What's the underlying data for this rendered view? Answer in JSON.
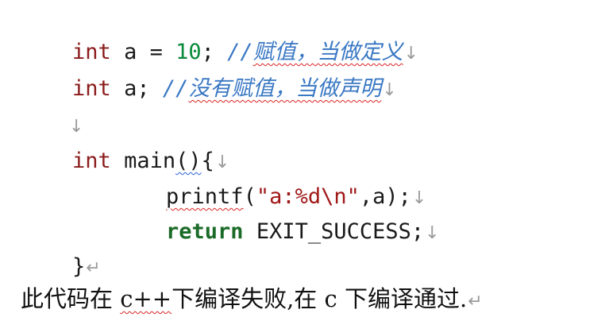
{
  "code": {
    "line1": {
      "type": "int",
      "decl": " a = ",
      "value": "10",
      "semi": "; ",
      "comment_prefix": "//",
      "comment_text": "赋值，当做定义",
      "mark": "↓"
    },
    "line2": {
      "type": "int",
      "decl": " a; ",
      "comment_prefix": "//",
      "comment_text": "没有赋值，当做声明",
      "mark": "↓"
    },
    "line3": {
      "mark": "↓"
    },
    "line4": {
      "type": "int",
      "name": " main",
      "parens": "()",
      "brace": "{",
      "mark": "↓"
    },
    "line5": {
      "func": "printf",
      "open": "(",
      "string": "\"a:%d\\n\"",
      "rest": ",a);",
      "mark": "↓"
    },
    "line6": {
      "keyword": "return",
      "rest": " EXIT_SUCCESS;",
      "mark": "↓"
    },
    "line7": {
      "brace": "}",
      "mark": "↵"
    }
  },
  "prose": {
    "part1": "此代码在 ",
    "lang1": "c++",
    "part2": "下编译失败,在 c 下编译通过.",
    "mark": "↵"
  }
}
